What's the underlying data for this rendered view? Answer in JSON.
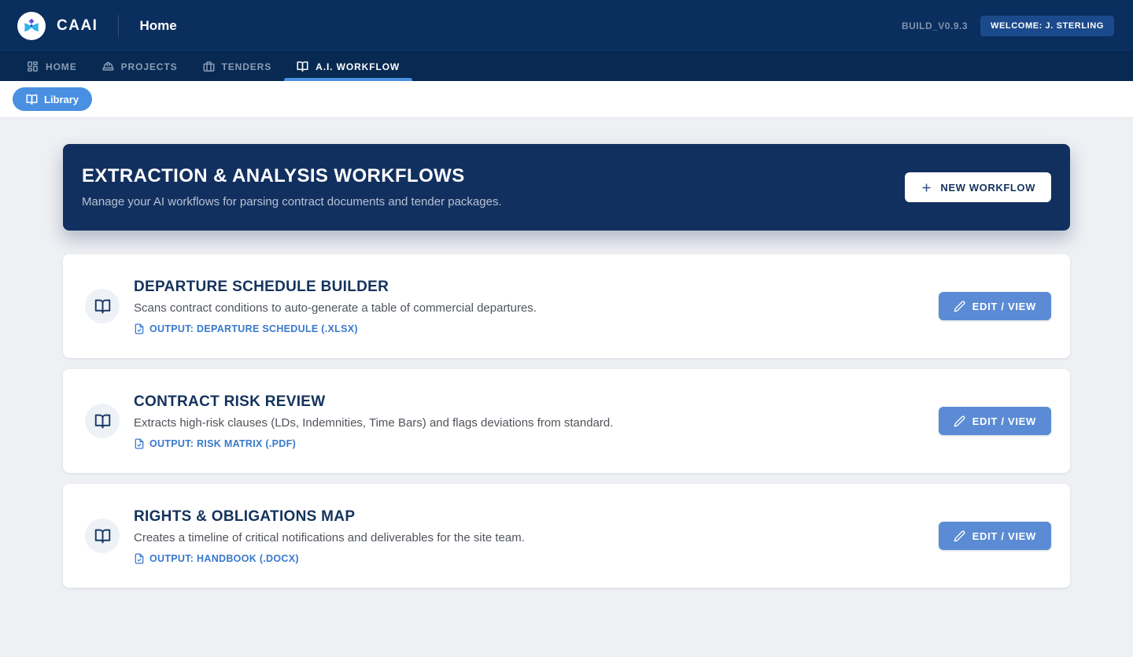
{
  "header": {
    "brand": "CAAI",
    "page_title": "Home",
    "build_label": "BUILD_V0.9.3",
    "welcome_badge": "WELCOME: J. STERLING"
  },
  "nav": {
    "tabs": [
      {
        "label": "HOME",
        "icon": "dashboard-icon",
        "active": false
      },
      {
        "label": "PROJECTS",
        "icon": "hardhat-icon",
        "active": false
      },
      {
        "label": "TENDERS",
        "icon": "briefcase-icon",
        "active": false
      },
      {
        "label": "A.I. WORKFLOW",
        "icon": "book-open-icon",
        "active": true
      }
    ]
  },
  "toolbar": {
    "library_label": "Library"
  },
  "hero": {
    "title": "EXTRACTION & ANALYSIS WORKFLOWS",
    "subtitle": "Manage your AI workflows for parsing contract documents and tender packages.",
    "new_workflow_label": "NEW WORKFLOW"
  },
  "workflows": [
    {
      "title": "DEPARTURE SCHEDULE BUILDER",
      "description": "Scans contract conditions to auto-generate a table of commercial departures.",
      "output_label": "OUTPUT: DEPARTURE SCHEDULE (.XLSX)",
      "action_label": "EDIT / VIEW",
      "icon": "book-open-icon"
    },
    {
      "title": "CONTRACT RISK REVIEW",
      "description": "Extracts high-risk clauses (LDs, Indemnities, Time Bars) and flags deviations from standard.",
      "output_label": "OUTPUT: RISK MATRIX (.PDF)",
      "action_label": "EDIT / VIEW",
      "icon": "book-open-icon"
    },
    {
      "title": "RIGHTS & OBLIGATIONS MAP",
      "description": "Creates a timeline of critical notifications and deliverables for the site team.",
      "output_label": "OUTPUT: HANDBOOK (.DOCX)",
      "action_label": "EDIT / VIEW",
      "icon": "book-open-icon"
    }
  ],
  "colors": {
    "header_bg": "#0a2e5d",
    "navbar_bg": "#082a52",
    "hero_bg": "#12305f",
    "accent_blue": "#4a90e2",
    "edit_button_blue": "#5b8bd4",
    "output_link_blue": "#3879cc",
    "title_navy": "#14335c",
    "page_bg": "#eef0f4"
  }
}
